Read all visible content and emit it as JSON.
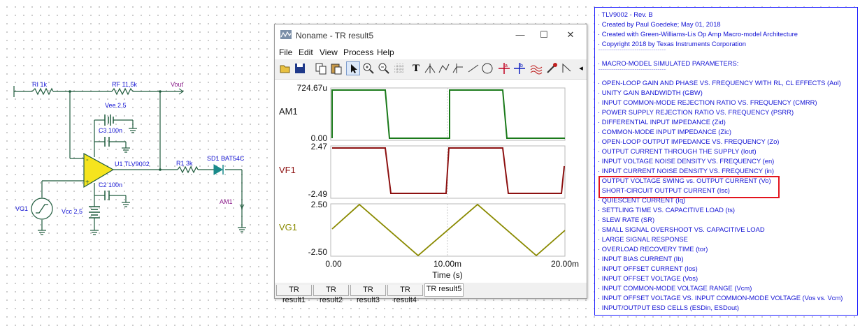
{
  "schematic": {
    "ri_label": "RI 1k",
    "rf_label": "RF 11,5k",
    "vout_label": "Vout",
    "vee_label": "Vee 2,5",
    "c3_label": "C3 100n",
    "u1_label": "U1 TLV9002",
    "r1_label": "R1 3k",
    "sd1_label": "SD1 BAT54C",
    "c2_label": "C2 100n",
    "vg1_label": "VG1",
    "vcc_label": "Vcc 2,5",
    "am1_label": "AM1",
    "plus_sign": "+",
    "minus_sign": "-"
  },
  "window": {
    "title": "Noname - TR result5",
    "minimize": "—",
    "maximize": "☐",
    "close": "✕",
    "menu": [
      "File",
      "Edit",
      "View",
      "Process",
      "Help"
    ]
  },
  "toolbar": {
    "text_tool": "T",
    "nav_left": "◂",
    "nav_right": "▸"
  },
  "plot": {
    "traces": [
      {
        "name": "AM1",
        "color": "#1a7a1a",
        "ytop": "724.67u",
        "ybottom": "0.00"
      },
      {
        "name": "VF1",
        "color": "#8c1010",
        "ytop": "2.47",
        "ybottom": "-2.49"
      },
      {
        "name": "VG1",
        "color": "#8a8a00",
        "ytop": "2.50",
        "ybottom": "-2.50"
      }
    ],
    "xticks": [
      "0.00",
      "10.00m",
      "20.00m"
    ],
    "xlabel": "Time (s)"
  },
  "tabs": [
    "TR result1",
    "TR result2",
    "TR result3",
    "TR result4",
    "TR result5"
  ],
  "active_tab": "TR result5",
  "params": [
    "· TLV9002 - Rev. B",
    "· Created by Paul Goedeke; May 01, 2018",
    "· Created with Green-Williams-Lis Op Amp Macro-model Architecture",
    "· Copyright 2018 by Texas Instruments Corporation",
    "·································································",
    "· MACRO-MODEL SIMULATED PARAMETERS:",
    "·································································",
    "· OPEN-LOOP GAIN AND PHASE VS. FREQUENCY  WITH RL, CL EFFECTS (Aol)",
    "· UNITY GAIN BANDWIDTH (GBW)",
    "· INPUT COMMON-MODE REJECTION RATIO VS. FREQUENCY (CMRR)",
    "· POWER SUPPLY REJECTION RATIO VS. FREQUENCY (PSRR)",
    "· DIFFERENTIAL INPUT IMPEDANCE (Zid)",
    "· COMMON-MODE INPUT IMPEDANCE (Zic)",
    "· OPEN-LOOP OUTPUT IMPEDANCE VS. FREQUENCY (Zo)",
    "· OUTPUT CURRENT THROUGH THE SUPPLY (Iout)",
    "· INPUT VOLTAGE NOISE DENSITY VS. FREQUENCY (en)",
    "· INPUT CURRENT NOISE DENSITY VS. FREQUENCY (in)",
    "· OUTPUT VOLTAGE SWING vs. OUTPUT CURRENT (Vo)",
    "· SHORT-CIRCUIT OUTPUT CURRENT (Isc)",
    "· QUIESCENT CURRENT (Iq)",
    "· SETTLING TIME VS. CAPACITIVE LOAD (ts)",
    "· SLEW RATE (SR)",
    "· SMALL SIGNAL OVERSHOOT VS. CAPACITIVE LOAD",
    "· LARGE SIGNAL RESPONSE",
    "· OVERLOAD RECOVERY TIME (tor)",
    "· INPUT BIAS CURRENT (Ib)",
    "· INPUT OFFSET CURRENT (Ios)",
    "· INPUT OFFSET VOLTAGE (Vos)",
    "· INPUT COMMON-MODE VOLTAGE RANGE (Vcm)",
    "· INPUT OFFSET VOLTAGE VS. INPUT COMMON-MODE VOLTAGE (Vos vs. Vcm)",
    "· INPUT/OUTPUT ESD CELLS (ESDin, ESDout)"
  ],
  "colors": {
    "schematic_wire": "#1e5a3c",
    "label_blue": "#1414d4",
    "label_purple": "#8a1a8a",
    "opamp_fill": "#f5e41e",
    "diode": "#1a8a8a",
    "highlight": "#e3141e"
  }
}
